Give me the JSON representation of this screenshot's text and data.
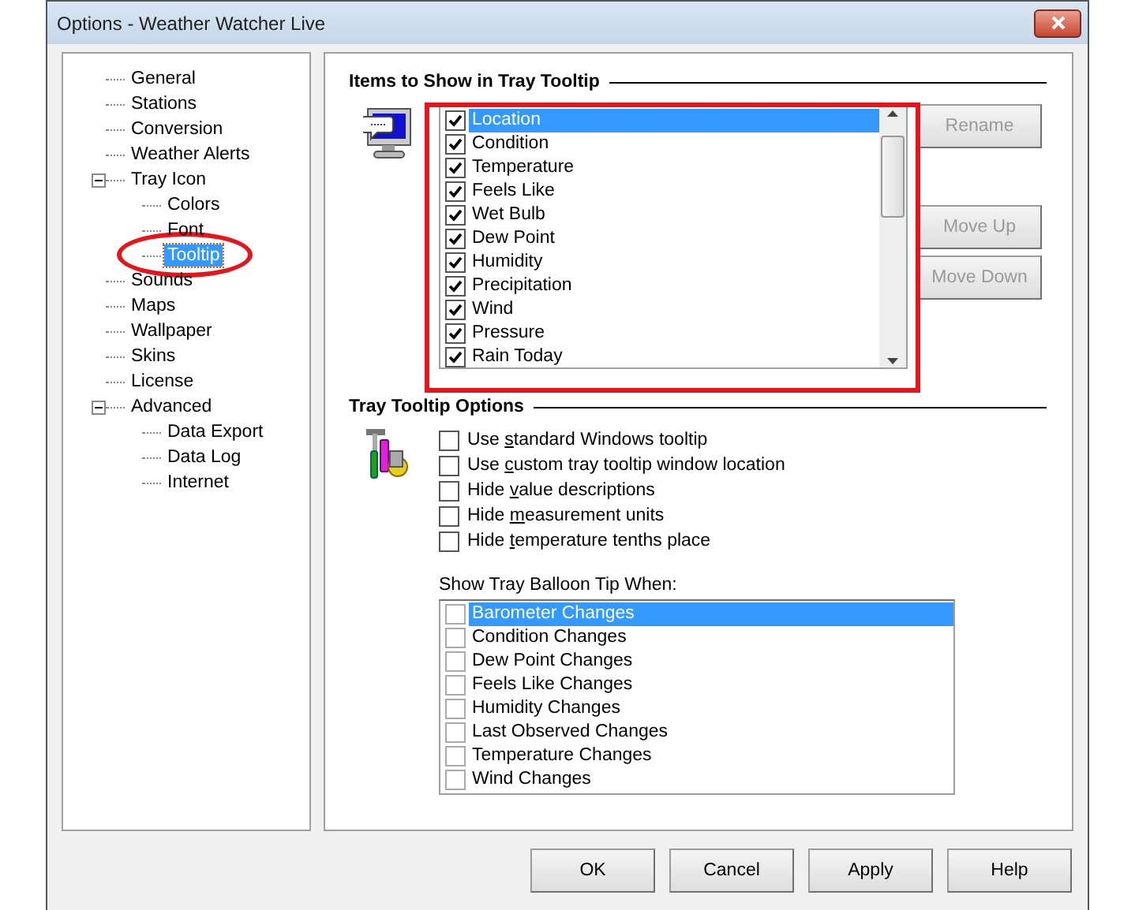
{
  "window": {
    "title": "Options - Weather Watcher Live"
  },
  "tree": [
    {
      "label": "General",
      "selected": false
    },
    {
      "label": "Stations",
      "selected": false
    },
    {
      "label": "Conversion",
      "selected": false
    },
    {
      "label": "Weather Alerts",
      "selected": false
    },
    {
      "label": "Tray Icon",
      "selected": false,
      "expanded": true,
      "children": [
        {
          "label": "Colors",
          "selected": false
        },
        {
          "label": "Font",
          "selected": false
        },
        {
          "label": "Tooltip",
          "selected": true
        }
      ]
    },
    {
      "label": "Sounds",
      "selected": false
    },
    {
      "label": "Maps",
      "selected": false
    },
    {
      "label": "Wallpaper",
      "selected": false
    },
    {
      "label": "Skins",
      "selected": false
    },
    {
      "label": "License",
      "selected": false
    },
    {
      "label": "Advanced",
      "selected": false,
      "expanded": true,
      "children": [
        {
          "label": "Data Export",
          "selected": false
        },
        {
          "label": "Data Log",
          "selected": false
        },
        {
          "label": "Internet",
          "selected": false
        }
      ]
    }
  ],
  "items_section": {
    "title": "Items to Show in Tray Tooltip",
    "items": [
      {
        "label": "Location",
        "checked": true,
        "selected": true
      },
      {
        "label": "Condition",
        "checked": true,
        "selected": false
      },
      {
        "label": "Temperature",
        "checked": true,
        "selected": false
      },
      {
        "label": "Feels Like",
        "checked": true,
        "selected": false
      },
      {
        "label": "Wet Bulb",
        "checked": true,
        "selected": false
      },
      {
        "label": "Dew Point",
        "checked": true,
        "selected": false
      },
      {
        "label": "Humidity",
        "checked": true,
        "selected": false
      },
      {
        "label": "Precipitation",
        "checked": true,
        "selected": false
      },
      {
        "label": "Wind",
        "checked": true,
        "selected": false
      },
      {
        "label": "Pressure",
        "checked": true,
        "selected": false
      },
      {
        "label": "Rain Today",
        "checked": true,
        "selected": false
      }
    ],
    "buttons": [
      {
        "label": "Rename",
        "disabled": true
      },
      {
        "label": "Move Up",
        "disabled": true
      },
      {
        "label": "Move Down",
        "disabled": true
      }
    ]
  },
  "options_section": {
    "title": "Tray Tooltip Options",
    "options": [
      {
        "label_parts": [
          "Use ",
          "s",
          "tandard Windows tooltip"
        ],
        "checked": false
      },
      {
        "label_parts": [
          "Use ",
          "c",
          "ustom tray tooltip window location"
        ],
        "checked": false
      },
      {
        "label_parts": [
          "Hide ",
          "v",
          "alue descriptions"
        ],
        "checked": false
      },
      {
        "label_parts": [
          "Hide ",
          "m",
          "easurement units"
        ],
        "checked": false
      },
      {
        "label_parts": [
          "Hide ",
          "t",
          "emperature tenths place"
        ],
        "checked": false
      }
    ],
    "balloon_label": "Show Tray Balloon Tip When:",
    "balloon_items": [
      {
        "label": "Barometer Changes",
        "checked": false,
        "selected": true
      },
      {
        "label": "Condition Changes",
        "checked": false,
        "selected": false
      },
      {
        "label": "Dew Point Changes",
        "checked": false,
        "selected": false
      },
      {
        "label": "Feels Like Changes",
        "checked": false,
        "selected": false
      },
      {
        "label": "Humidity Changes",
        "checked": false,
        "selected": false
      },
      {
        "label": "Last Observed Changes",
        "checked": false,
        "selected": false
      },
      {
        "label": "Temperature Changes",
        "checked": false,
        "selected": false
      },
      {
        "label": "Wind Changes",
        "checked": false,
        "selected": false
      }
    ]
  },
  "annotations": [
    {
      "kind": "ellipse"
    },
    {
      "kind": "rectangle"
    }
  ],
  "footer_buttons": [
    {
      "label": "OK",
      "disabled": false
    },
    {
      "label": "Cancel",
      "disabled": false
    },
    {
      "label": "Apply",
      "disabled": false
    },
    {
      "label": "Help",
      "disabled": false
    }
  ]
}
